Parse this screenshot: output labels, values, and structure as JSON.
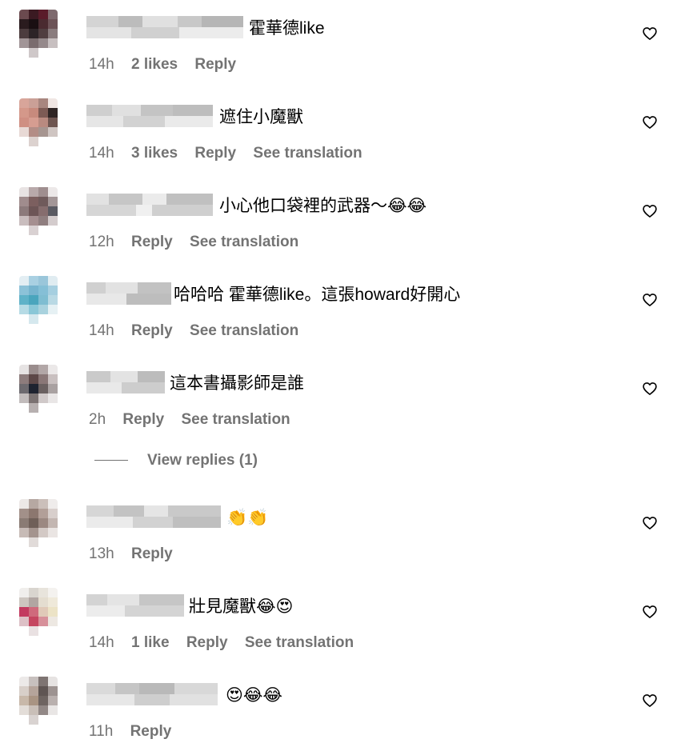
{
  "colors": {
    "secondary_text": "#737373",
    "primary_text": "#000000"
  },
  "comments": [
    {
      "text": "霍華德like",
      "time": "14h",
      "likes": "2 likes",
      "reply": "Reply",
      "translate": ""
    },
    {
      "text": "遮住小魔獸",
      "time": "14h",
      "likes": "3 likes",
      "reply": "Reply",
      "translate": "See translation"
    },
    {
      "text": "小心他口袋裡的武器～😂😂",
      "time": "12h",
      "likes": "",
      "reply": "Reply",
      "translate": "See translation"
    },
    {
      "text": "哈哈哈 霍華德like。這張howard好開心",
      "time": "14h",
      "likes": "",
      "reply": "Reply",
      "translate": "See translation"
    },
    {
      "text": "這本書攝影師是誰",
      "time": "2h",
      "likes": "",
      "reply": "Reply",
      "translate": "See translation"
    },
    {
      "text": "👏👏",
      "time": "13h",
      "likes": "",
      "reply": "Reply",
      "translate": ""
    },
    {
      "text": "壯見魔獸😂😍",
      "time": "14h",
      "likes": "1 like",
      "reply": "Reply",
      "translate": "See translation"
    },
    {
      "text": "😍😂😂",
      "time": "11h",
      "likes": "",
      "reply": "Reply",
      "translate": ""
    }
  ],
  "view_replies": "View replies (1)",
  "icons": {
    "like": "heart-outline-icon"
  }
}
